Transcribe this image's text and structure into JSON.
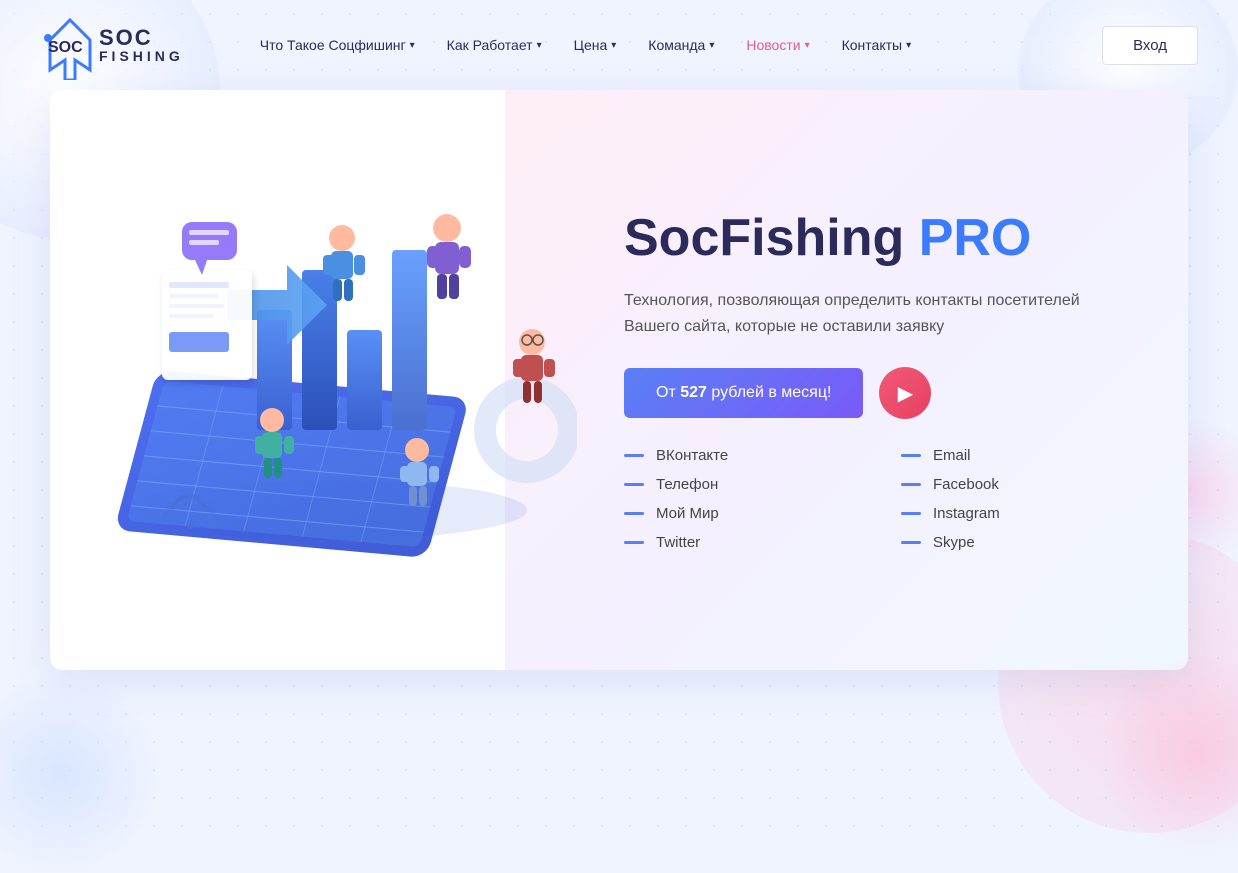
{
  "brand": {
    "soc": "SOC",
    "fishing": "FISHING"
  },
  "navbar": {
    "links": [
      {
        "label": "Что Такое Соцфишинг",
        "hasDropdown": true,
        "active": false
      },
      {
        "label": "Как Работает",
        "hasDropdown": true,
        "active": false
      },
      {
        "label": "Цена",
        "hasDropdown": true,
        "active": false
      },
      {
        "label": "Команда",
        "hasDropdown": true,
        "active": false
      },
      {
        "label": "Новости",
        "hasDropdown": true,
        "active": true
      },
      {
        "label": "Контакты",
        "hasDropdown": true,
        "active": false
      }
    ],
    "login_label": "Вход"
  },
  "hero": {
    "title_main": "SocFishing ",
    "title_pro": "PRO",
    "subtitle": "Технология, позволяющая определить контакты посетителей Вашего сайта, которые не оставили заявку",
    "cta_button": "От 527 рублей в месяц!",
    "features": [
      {
        "label": "ВКонтакте"
      },
      {
        "label": "Email"
      },
      {
        "label": "Телефон"
      },
      {
        "label": "Facebook"
      },
      {
        "label": "Мой Мир"
      },
      {
        "label": "Instagram"
      },
      {
        "label": "Twitter"
      },
      {
        "label": "Skype"
      }
    ]
  },
  "colors": {
    "accent_blue": "#3a7bff",
    "accent_purple": "#7a5af8",
    "accent_red": "#e84060",
    "nav_active": "#e85a8a",
    "text_dark": "#2b2b5b",
    "dash_color": "#5a7ff5"
  }
}
